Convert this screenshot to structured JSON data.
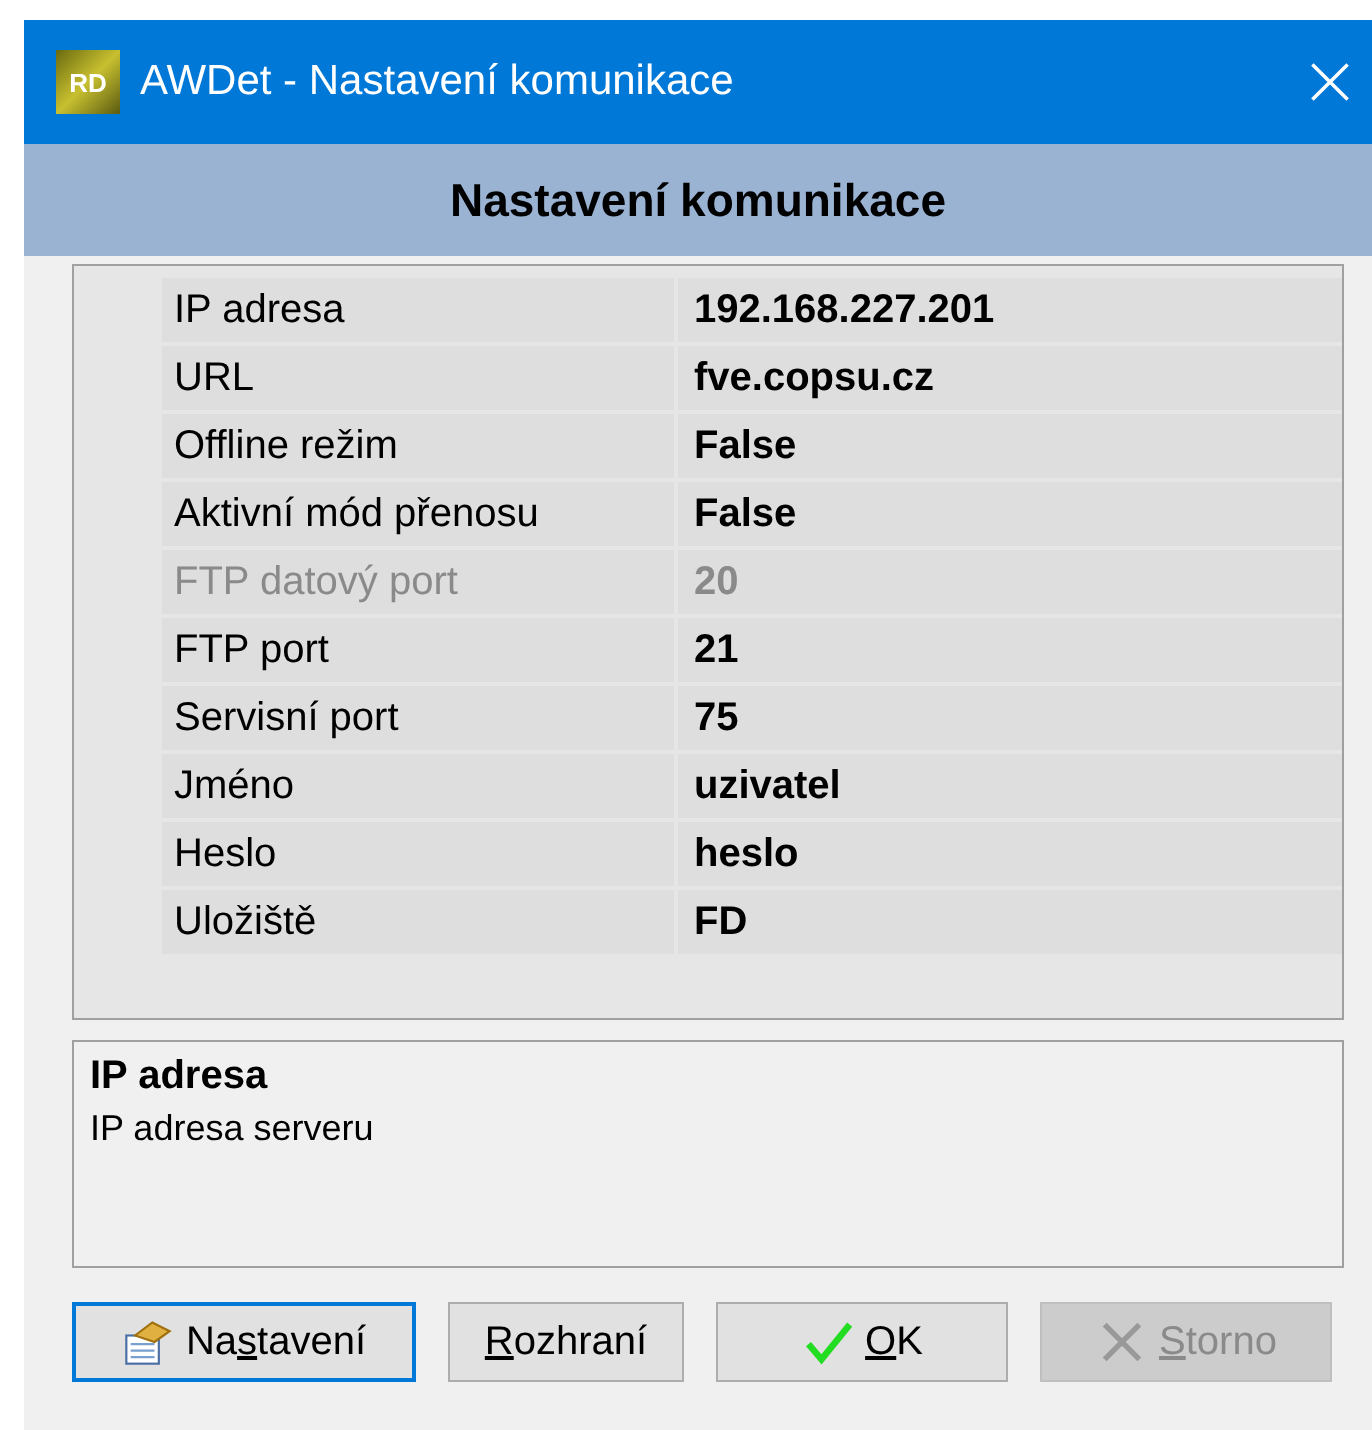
{
  "window": {
    "title": "AWDet - Nastavení komunikace",
    "app_icon_text": "RD"
  },
  "header": {
    "title": "Nastavení komunikace"
  },
  "properties": [
    {
      "name": "IP adresa",
      "value": "192.168.227.201",
      "disabled": false
    },
    {
      "name": "URL",
      "value": "fve.copsu.cz",
      "disabled": false
    },
    {
      "name": "Offline režim",
      "value": "False",
      "disabled": false
    },
    {
      "name": "Aktivní mód přenosu",
      "value": "False",
      "disabled": false
    },
    {
      "name": "FTP datový port",
      "value": "20",
      "disabled": true
    },
    {
      "name": "FTP port",
      "value": "21",
      "disabled": false
    },
    {
      "name": "Servisní port",
      "value": "75",
      "disabled": false
    },
    {
      "name": "Jméno",
      "value": "uzivatel",
      "disabled": false
    },
    {
      "name": "Heslo",
      "value": "heslo",
      "disabled": false
    },
    {
      "name": "Uložiště",
      "value": "FD",
      "disabled": false
    }
  ],
  "description": {
    "title": "IP adresa",
    "text": "IP adresa serveru"
  },
  "buttons": [
    {
      "kind": "settings",
      "label": {
        "before": "Na",
        "key": "s",
        "after": "tavení"
      },
      "focused": true,
      "disabled": false
    },
    {
      "kind": "plain",
      "label": {
        "key": "R",
        "after": "ozhraní"
      },
      "focused": false,
      "disabled": false
    },
    {
      "kind": "ok",
      "label": {
        "key": "O",
        "after": "K"
      },
      "focused": false,
      "disabled": false
    },
    {
      "kind": "cancel",
      "label": {
        "key": "S",
        "after": "torno"
      },
      "focused": false,
      "disabled": true
    }
  ]
}
